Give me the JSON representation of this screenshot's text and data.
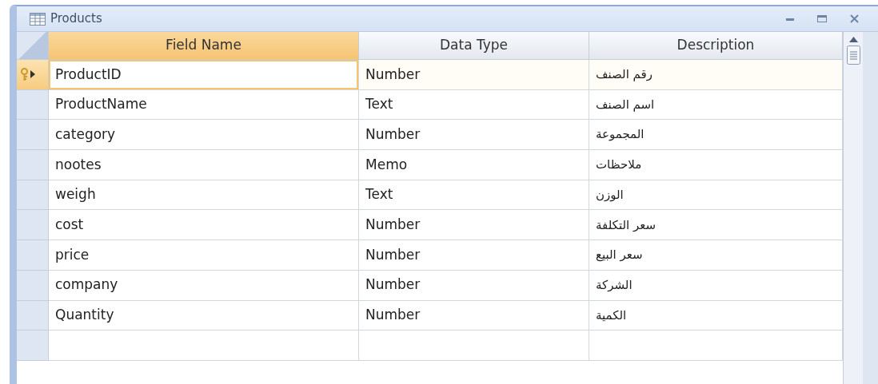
{
  "window": {
    "title": "Products"
  },
  "table": {
    "columns": [
      "Field Name",
      "Data Type",
      "Description"
    ],
    "rows": [
      {
        "field_name": "ProductID",
        "data_type": "Number",
        "description": "رقم الصنف",
        "selected": true,
        "primary_key": true
      },
      {
        "field_name": "ProductName",
        "data_type": "Text",
        "description": "اسم الصنف",
        "selected": false,
        "primary_key": false
      },
      {
        "field_name": "category",
        "data_type": "Number",
        "description": "المجموعة",
        "selected": false,
        "primary_key": false
      },
      {
        "field_name": "nootes",
        "data_type": "Memo",
        "description": "ملاحظات",
        "selected": false,
        "primary_key": false
      },
      {
        "field_name": "weigh",
        "data_type": "Text",
        "description": "الوزن",
        "selected": false,
        "primary_key": false
      },
      {
        "field_name": "cost",
        "data_type": "Number",
        "description": "سعر التكلفة",
        "selected": false,
        "primary_key": false
      },
      {
        "field_name": "price",
        "data_type": "Number",
        "description": "سعر البيع",
        "selected": false,
        "primary_key": false
      },
      {
        "field_name": "company",
        "data_type": "Number",
        "description": "الشركة",
        "selected": false,
        "primary_key": false
      },
      {
        "field_name": "Quantity",
        "data_type": "Number",
        "description": "الكمية",
        "selected": false,
        "primary_key": false
      }
    ]
  }
}
